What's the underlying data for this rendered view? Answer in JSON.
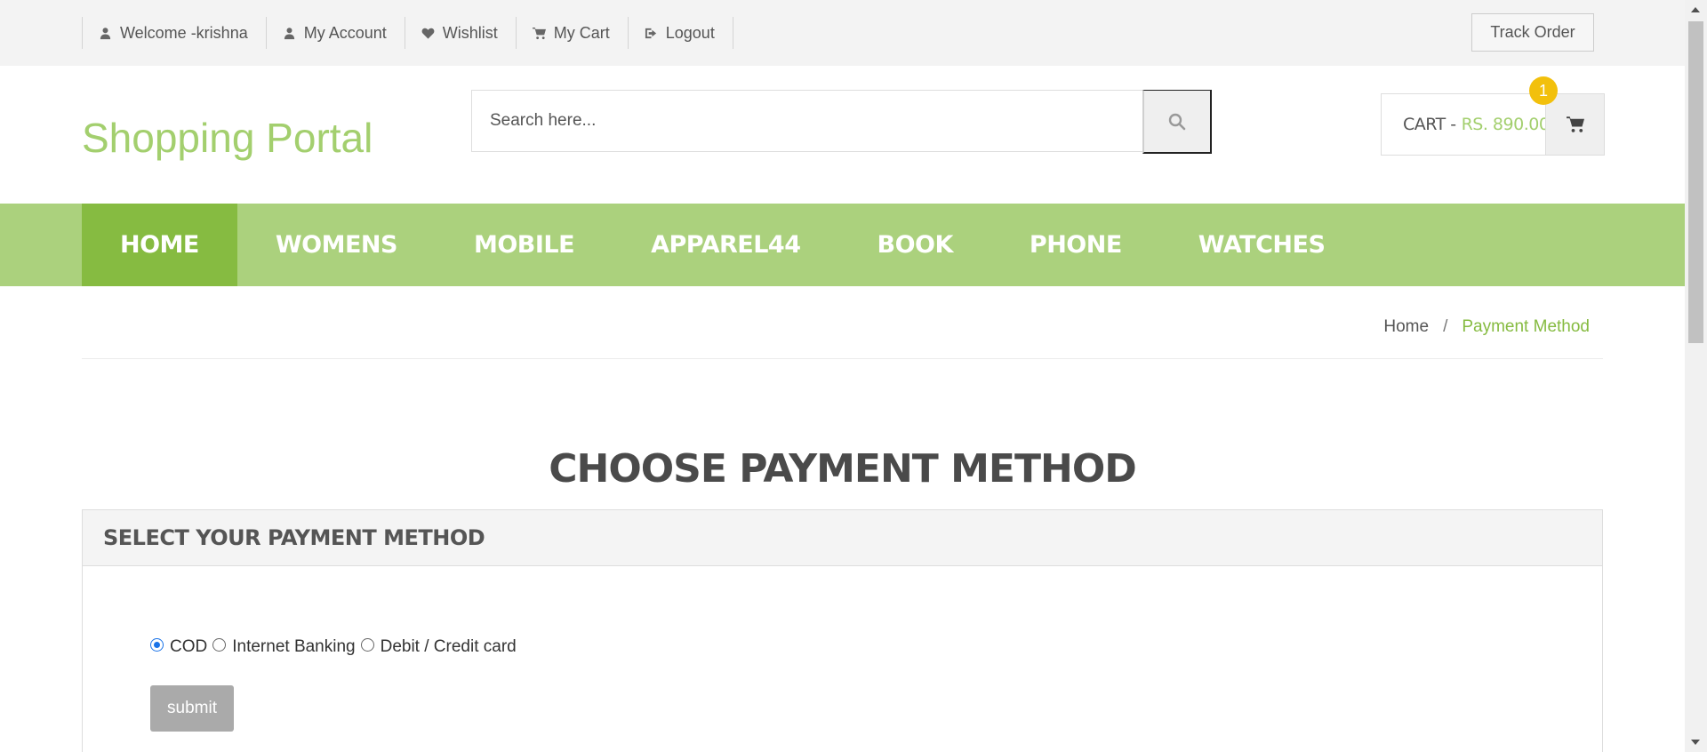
{
  "topbar": {
    "links": [
      {
        "label": "Welcome -krishna",
        "icon": "user-icon"
      },
      {
        "label": "My Account",
        "icon": "user-icon"
      },
      {
        "label": "Wishlist",
        "icon": "heart-icon"
      },
      {
        "label": "My Cart",
        "icon": "cart-icon"
      },
      {
        "label": "Logout",
        "icon": "logout-icon"
      }
    ],
    "track_order": "Track Order"
  },
  "header": {
    "logo": "Shopping Portal",
    "search_placeholder": "Search here...",
    "cart": {
      "label": "CART -",
      "amount": "RS. 890.00",
      "count": "1"
    }
  },
  "nav": {
    "items": [
      "HOME",
      "WOMENS",
      "MOBILE",
      "APPAREL44",
      "BOOK",
      "PHONE",
      "WATCHES"
    ],
    "active": "HOME"
  },
  "breadcrumb": {
    "home": "Home",
    "separator": "/",
    "current": "Payment Method"
  },
  "main": {
    "heading": "CHOOSE PAYMENT METHOD",
    "panel_title": "SELECT YOUR PAYMENT METHOD",
    "options": [
      {
        "label": "COD",
        "checked": true
      },
      {
        "label": "Internet Banking",
        "checked": false
      },
      {
        "label": "Debit / Credit card",
        "checked": false
      }
    ],
    "submit": "submit"
  },
  "colors": {
    "accent": "#a3cf6e",
    "nav_bg": "#abd17d",
    "nav_active": "#86bb41",
    "badge": "#f2c00c"
  }
}
